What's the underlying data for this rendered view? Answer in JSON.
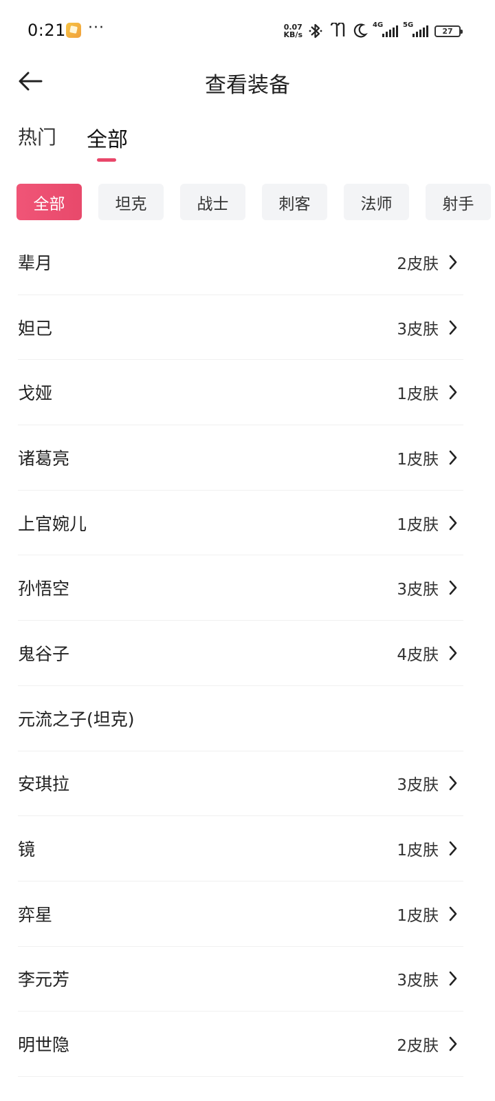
{
  "status": {
    "time": "0:21",
    "dots": "···",
    "speed_value": "0.07",
    "speed_unit": "KB/s",
    "sim1_label": "4G",
    "sim2_label": "5G",
    "battery": "27"
  },
  "header": {
    "title": "查看装备"
  },
  "tabs": [
    {
      "label": "热门"
    },
    {
      "label": "全部"
    }
  ],
  "filters": [
    {
      "label": "全部"
    },
    {
      "label": "坦克"
    },
    {
      "label": "战士"
    },
    {
      "label": "刺客"
    },
    {
      "label": "法师"
    },
    {
      "label": "射手"
    }
  ],
  "heroes": [
    {
      "name": "辈月",
      "skins": "2皮肤"
    },
    {
      "name": "妲己",
      "skins": "3皮肤"
    },
    {
      "name": "戈娅",
      "skins": "1皮肤"
    },
    {
      "name": "诸葛亮",
      "skins": "1皮肤"
    },
    {
      "name": "上官婉儿",
      "skins": "1皮肤"
    },
    {
      "name": "孙悟空",
      "skins": "3皮肤"
    },
    {
      "name": "鬼谷子",
      "skins": "4皮肤"
    },
    {
      "name": "元流之子(坦克)",
      "skins": ""
    },
    {
      "name": "安琪拉",
      "skins": "3皮肤"
    },
    {
      "name": "镜",
      "skins": "1皮肤"
    },
    {
      "name": "弈星",
      "skins": "1皮肤"
    },
    {
      "name": "李元芳",
      "skins": "3皮肤"
    },
    {
      "name": "明世隐",
      "skins": "2皮肤"
    }
  ],
  "colors": {
    "accent": "#e9476a",
    "chip_bg": "#f3f4f6"
  }
}
